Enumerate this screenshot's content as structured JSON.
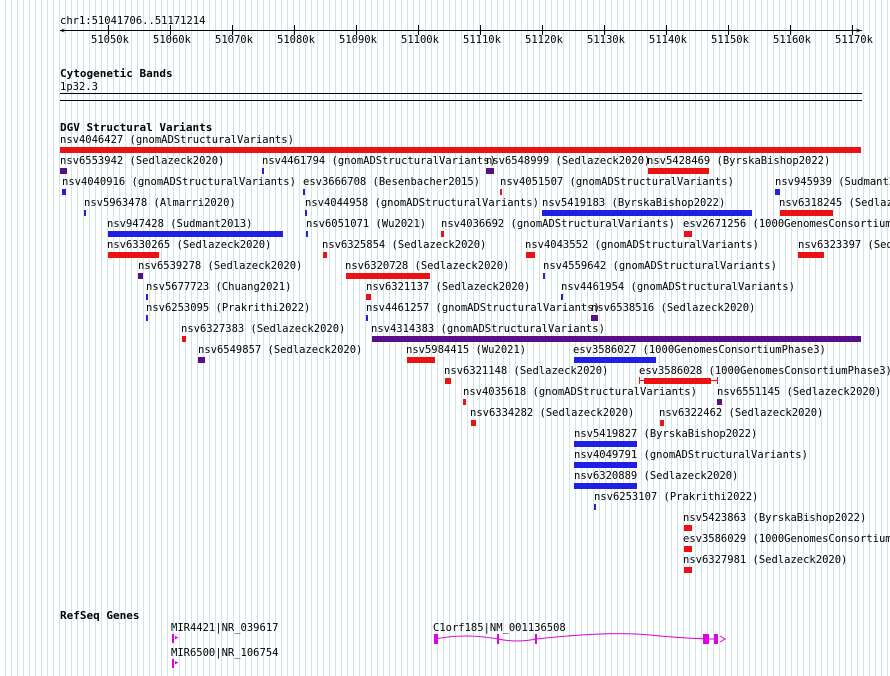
{
  "ruler": {
    "position": "chr1:51041706..51171214",
    "ticks": [
      "51050k",
      "51060k",
      "51070k",
      "51080k",
      "51090k",
      "51100k",
      "51110k",
      "51120k",
      "51130k",
      "51140k",
      "51150k",
      "51160k",
      "51170k"
    ]
  },
  "cyto": {
    "title": "Cytogenetic Bands",
    "band": "1p32.3"
  },
  "dgv": {
    "title": "DGV Structural Variants",
    "colors": {
      "gain": "#1f1fe6",
      "loss": "#ee1111",
      "both": "#5a0f8a"
    },
    "features": [
      {
        "label": "nsv4046427 (gnomADStructuralVariants)",
        "type": "loss"
      },
      {
        "label": "nsv6553942 (Sedlazeck2020)",
        "type": "both"
      },
      {
        "label": "nsv4461794 (gnomADStructuralVariants)",
        "type": "gain"
      },
      {
        "label": "nsv6548999 (Sedlazeck2020)",
        "type": "both"
      },
      {
        "label": "nsv5428469 (ByrskaBishop2022)",
        "type": "loss"
      },
      {
        "label": "nsv4040916 (gnomADStructuralVariants)",
        "type": "gain"
      },
      {
        "label": "esv3666708 (Besenbacher2015)",
        "type": "gain"
      },
      {
        "label": "nsv4051507 (gnomADStructuralVariants)",
        "type": "loss"
      },
      {
        "label": "nsv945939 (Sudmant2",
        "type": "gain"
      },
      {
        "label": "nsv5963478 (Almarri2020)",
        "type": "gain"
      },
      {
        "label": "nsv4044958 (gnomADStructuralVariants)",
        "type": "gain"
      },
      {
        "label": "nsv5419183 (ByrskaBishop2022)",
        "type": "gain"
      },
      {
        "label": "nsv6318245 (Sedlaz",
        "type": "loss"
      },
      {
        "label": "nsv947428 (Sudmant2013)",
        "type": "gain"
      },
      {
        "label": "nsv6051071 (Wu2021)",
        "type": "gain"
      },
      {
        "label": "nsv4036692 (gnomADStructuralVariants)",
        "type": "loss"
      },
      {
        "label": "esv2671256 (1000GenomesConsortiumPh",
        "type": "loss"
      },
      {
        "label": "nsv6330265 (Sedlazeck2020)",
        "type": "loss"
      },
      {
        "label": "nsv6325854 (Sedlazeck2020)",
        "type": "loss"
      },
      {
        "label": "nsv4043552 (gnomADStructuralVariants)",
        "type": "loss"
      },
      {
        "label": "nsv6323397 (Sed",
        "type": "loss"
      },
      {
        "label": "nsv6539278 (Sedlazeck2020)",
        "type": "both"
      },
      {
        "label": "nsv6320728 (Sedlazeck2020)",
        "type": "loss"
      },
      {
        "label": "nsv4559642 (gnomADStructuralVariants)",
        "type": "gain"
      },
      {
        "label": "nsv5677723 (Chuang2021)",
        "type": "gain"
      },
      {
        "label": "nsv6321137 (Sedlazeck2020)",
        "type": "loss"
      },
      {
        "label": "nsv4461954 (gnomADStructuralVariants)",
        "type": "gain"
      },
      {
        "label": "nsv6253095 (Prakrithi2022)",
        "type": "gain"
      },
      {
        "label": "nsv4461257 (gnomADStructuralVariants)",
        "type": "gain"
      },
      {
        "label": "nsv6538516 (Sedlazeck2020)",
        "type": "both"
      },
      {
        "label": "nsv6327383 (Sedlazeck2020)",
        "type": "loss"
      },
      {
        "label": "nsv4314383 (gnomADStructuralVariants)",
        "type": "both"
      },
      {
        "label": "nsv6549857 (Sedlazeck2020)",
        "type": "both"
      },
      {
        "label": "nsv5984415 (Wu2021)",
        "type": "loss"
      },
      {
        "label": "esv3586027 (1000GenomesConsortiumPhase3)",
        "type": "gain"
      },
      {
        "label": "nsv6321148 (Sedlazeck2020)",
        "type": "loss"
      },
      {
        "label": "esv3586028 (1000GenomesConsortiumPhase3)",
        "type": "loss"
      },
      {
        "label": "nsv4035618 (gnomADStructuralVariants)",
        "type": "loss"
      },
      {
        "label": "nsv6551145 (Sedlazeck2020)",
        "type": "both"
      },
      {
        "label": "nsv6334282 (Sedlazeck2020)",
        "type": "loss"
      },
      {
        "label": "nsv6322462 (Sedlazeck2020)",
        "type": "loss"
      },
      {
        "label": "nsv5419827 (ByrskaBishop2022)",
        "type": "gain"
      },
      {
        "label": "nsv4049791 (gnomADStructuralVariants)",
        "type": "gain"
      },
      {
        "label": "nsv6320889 (Sedlazeck2020)",
        "type": "gain"
      },
      {
        "label": "nsv6253107 (Prakrithi2022)",
        "type": "gain"
      },
      {
        "label": "nsv5423863 (ByrskaBishop2022)",
        "type": "loss"
      },
      {
        "label": "esv3586029 (1000GenomesConsortiumPh",
        "type": "loss"
      },
      {
        "label": "nsv6327981 (Sedlazeck2020)",
        "type": "loss"
      }
    ]
  },
  "refseq": {
    "title": "RefSeq Genes",
    "gene_color": "#e000e0",
    "genes": [
      {
        "label": "MIR4421|NR_039617"
      },
      {
        "label": "MIR6500|NR_106754"
      },
      {
        "label": "C1orf185|NM_001136508"
      }
    ]
  }
}
